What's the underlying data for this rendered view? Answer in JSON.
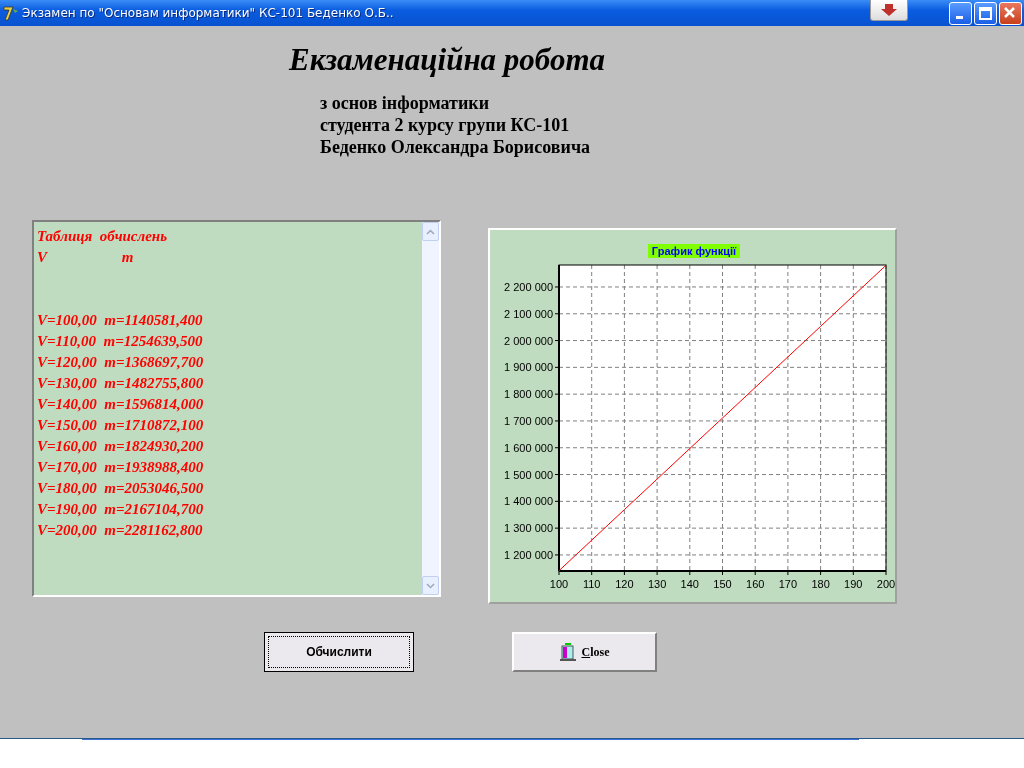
{
  "window": {
    "title": "Экзамен по \"Основам информатики\" КС-101 Беденко О.Б.."
  },
  "heading": "Екзаменаційна робота",
  "subtitle_lines": [
    "з основ інформатики",
    "студента 2 курсу групи КС-101",
    "Беденко Олександра Борисовича"
  ],
  "memo": {
    "header_lines": [
      "Таблиця  обчислень",
      "V                    m"
    ],
    "lines": [
      "V=100,00  m=1140581,400",
      "V=110,00  m=1254639,500",
      "V=120,00  m=1368697,700",
      "V=130,00  m=1482755,800",
      "V=140,00  m=1596814,000",
      "V=150,00  m=1710872,100",
      "V=160,00  m=1824930,200",
      "V=170,00  m=1938988,400",
      "V=180,00  m=2053046,500",
      "V=190,00  m=2167104,700",
      "V=200,00  m=2281162,800"
    ]
  },
  "chart": {
    "chart_data": {
      "type": "line",
      "title": "График функції",
      "grid": true,
      "x": [
        100,
        110,
        120,
        130,
        140,
        150,
        160,
        170,
        180,
        190,
        200
      ],
      "series": [
        {
          "color": "#ff0000",
          "values": [
            1141000,
            1255000,
            1369000,
            1483000,
            1597000,
            1711000,
            1825000,
            1939000,
            2053000,
            2167000,
            2281000
          ]
        }
      ],
      "xlim": [
        100,
        200
      ],
      "ylim": [
        1140000,
        2282000
      ],
      "xticks": [
        100,
        110,
        120,
        130,
        140,
        150,
        160,
        170,
        180,
        190,
        200
      ],
      "yticks": [
        {
          "value": 1200000,
          "label": "1 200 000"
        },
        {
          "value": 1300000,
          "label": "1 300 000"
        },
        {
          "value": 1400000,
          "label": "1 400 000"
        },
        {
          "value": 1500000,
          "label": "1 500 000"
        },
        {
          "value": 1600000,
          "label": "1 600 000"
        },
        {
          "value": 1700000,
          "label": "1 700 000"
        },
        {
          "value": 1800000,
          "label": "1 800 000"
        },
        {
          "value": 1900000,
          "label": "1 900 000"
        },
        {
          "value": 2000000,
          "label": "2 000 000"
        },
        {
          "value": 2100000,
          "label": "2 100 000"
        },
        {
          "value": 2200000,
          "label": "2 200 000"
        }
      ]
    }
  },
  "buttons": [
    {
      "label": "Обчислити",
      "kind": "default"
    },
    {
      "label": "Close",
      "kind": "icon"
    }
  ]
}
